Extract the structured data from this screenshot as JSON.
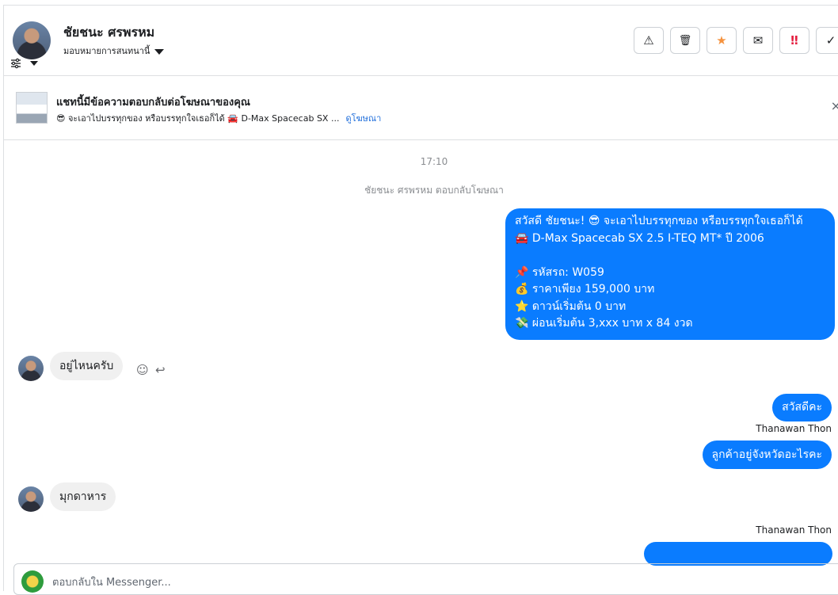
{
  "header": {
    "name": "ชัยชนะ ศรพรหม",
    "assign_label": "มอบหมายการสนทนานี้",
    "actions": [
      {
        "icon": "warning-icon",
        "glyph": "⚠"
      },
      {
        "icon": "trash-icon",
        "glyph": "🗑"
      },
      {
        "icon": "star-icon",
        "glyph": "★",
        "color": "#f5923e"
      },
      {
        "icon": "mark-unread-icon",
        "glyph": "✉"
      },
      {
        "icon": "priority-icon",
        "glyph": "‼",
        "color": "#e41e3f"
      },
      {
        "icon": "done-icon",
        "glyph": "✓"
      }
    ]
  },
  "ad": {
    "title": "แชทนี้มีข้อความตอบกลับต่อโฆษณาของคุณ",
    "description": "😎 จะเอาไปบรรทุกของ หรือบรรทุกใจเธอก็ได้ 🚘 D-Max Spacecab SX ...",
    "link": "ดูโฆษณา",
    "close": "×"
  },
  "thread": {
    "time": "17:10",
    "system_message": "ชัยชนะ ศรพรหม ตอบกลับโฆษณา",
    "ad_message_lines": [
      "สวัสดี ชัยชนะ! 😎 จะเอาไปบรรทุกของ หรือบรรทุกใจเธอก็ได้",
      "🚘 D-Max Spacecab SX 2.5 I-TEQ MT* ปี 2006",
      "",
      "📌 รหัสรถ: W059",
      "💰 ราคาเพียง 159,000 บาท",
      "⭐ ดาวน์เริ่มต้น 0 บาท",
      "💸 ผ่อนเริ่มต้น 3,xxx บาท x 84 งวด"
    ],
    "msg_customer_1": "อยู่ไหนครับ",
    "msg_agent_1": "สวัสดีคะ",
    "agent_name": "Thanawan Thon",
    "msg_agent_2": "ลูกค้าอยู่จังหวัดอะไรคะ",
    "msg_customer_2": "มุกดาหาร",
    "agent_name_2": "Thanawan Thon"
  },
  "composer": {
    "placeholder": "ตอบกลับใน Messenger..."
  }
}
